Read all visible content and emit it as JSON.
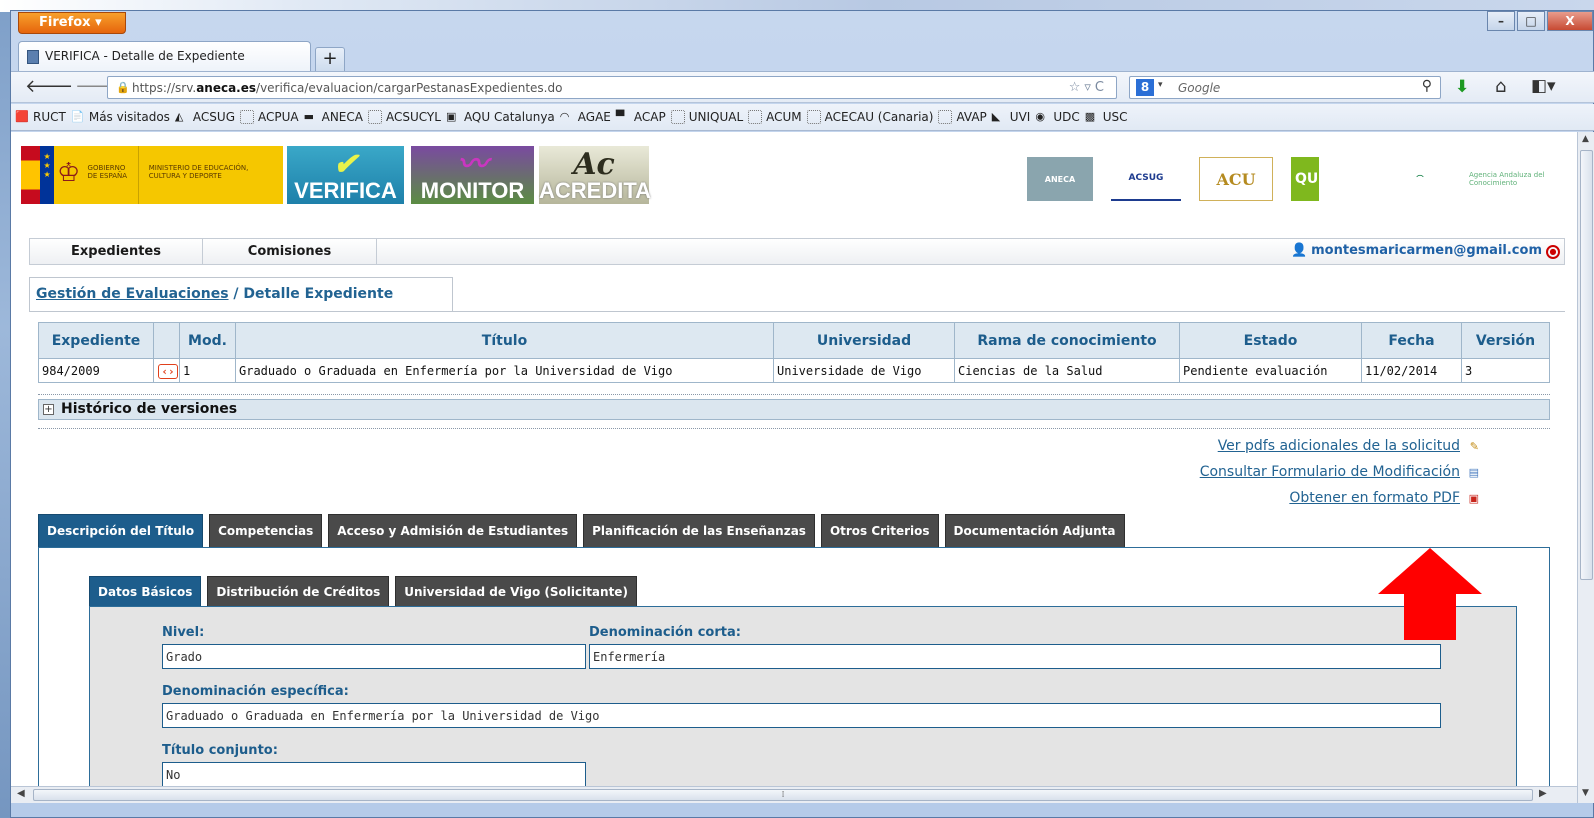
{
  "browser": {
    "menu_button": "Firefox",
    "tab_title": "VERIFICA - Detalle de Expediente",
    "new_tab": "+",
    "url_prefix": "https://srv.",
    "url_host": "aneca.es",
    "url_path": "/verifica/evaluacion/cargarPestanasExpedientes.do",
    "search_placeholder": "Google",
    "search_engine_letter": "8",
    "window_controls": [
      "–",
      "□",
      "X"
    ]
  },
  "bookmarks": [
    "RUCT",
    "Más visitados",
    "ACSUG",
    "ACPUA",
    "ANECA",
    "ACSUCYL",
    "AQU Catalunya",
    "AGAE",
    "ACAP",
    "UNIQUAL",
    "ACUM",
    "ACECAU (Canaria)",
    "AVAP",
    "UVI",
    "UDC",
    "USC"
  ],
  "logos": {
    "gobierno": "GOBIERNO DE ESPAÑA",
    "ministerio": "MINISTERIO DE EDUCACIÓN, CULTURA Y DEPORTE",
    "verifica": "VERIFICA",
    "monitor": "MONITOR",
    "acredita": "ACREDITA",
    "aneca": "ANECA",
    "acsuc": "ACSUG",
    "acu": "ACU",
    "aqu": "QU",
    "andalucia": "Agencia Andaluza del Conocimiento"
  },
  "menu": {
    "expedientes": "Expedientes",
    "comisiones": "Comisiones",
    "user_email": "montesmaricarmen@gmail.com"
  },
  "breadcrumb": {
    "link": "Gestión de Evaluaciones",
    "separator": "/",
    "current": "Detalle Expediente"
  },
  "table": {
    "headers": {
      "expediente": "Expediente",
      "mod": "Mod.",
      "titulo": "Título",
      "universidad": "Universidad",
      "rama": "Rama de conocimiento",
      "estado": "Estado",
      "fecha": "Fecha",
      "version": "Versión"
    },
    "row": {
      "expediente": "984/2009",
      "mod": "1",
      "titulo": "Graduado o Graduada en Enfermería por la Universidad de Vigo",
      "universidad": "Universidade de Vigo",
      "rama": "Ciencias de la Salud",
      "estado": "Pendiente evaluación",
      "fecha": "11/02/2014",
      "version": "3"
    }
  },
  "historico": {
    "expander": "+",
    "label": "Histórico de versiones"
  },
  "links": {
    "pdfs": "Ver pdfs adicionales de la solicitud",
    "formulario": "Consultar Formulario de Modificación",
    "pdf": "Obtener en formato PDF"
  },
  "main_tabs": [
    "Descripción del Título",
    "Competencias",
    "Acceso y Admisión de Estudiantes",
    "Planificación de las Enseñanzas",
    "Otros Criterios",
    "Documentación Adjunta"
  ],
  "sub_tabs": [
    "Datos Básicos",
    "Distribución de Créditos",
    "Universidad de Vigo (Solicitante)"
  ],
  "form": {
    "nivel_label": "Nivel:",
    "nivel_value": "Grado",
    "corta_label": "Denominación corta:",
    "corta_value": "Enfermería",
    "especifica_label": "Denominación específica:",
    "especifica_value": "Graduado o Graduada en Enfermería por la Universidad de Vigo",
    "conjunto_label": "Título conjunto:",
    "conjunto_value": "No"
  },
  "colors": {
    "tab_active": "#1d5d8c",
    "tab_inactive": "#4a4a4a",
    "link": "#226392",
    "arrow": "#ff0000"
  }
}
